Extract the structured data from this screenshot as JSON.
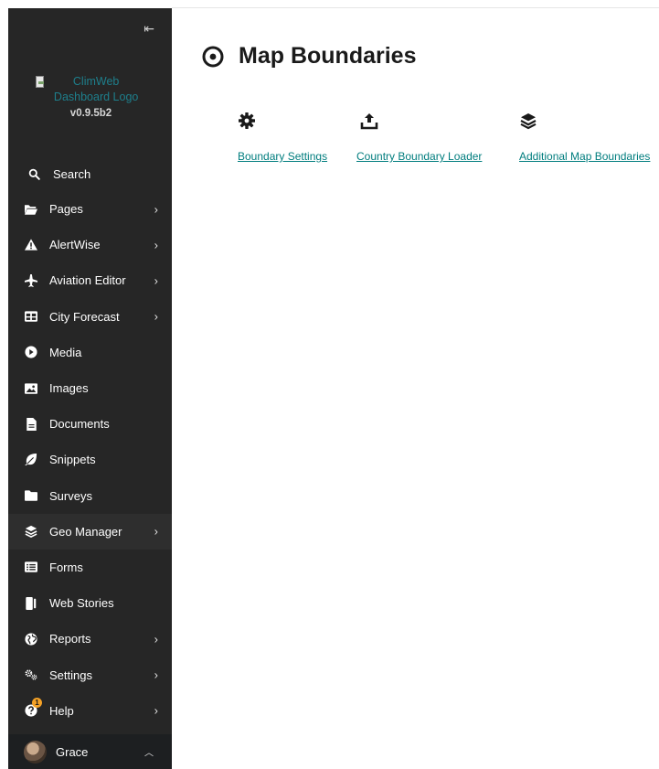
{
  "sidebar": {
    "collapse_label": "⇤",
    "logo_alt": "ClimWeb Dashboard Logo",
    "version": "v0.9.5b2",
    "search_label": "Search",
    "items": [
      {
        "label": "Pages",
        "icon": "folder-open-icon",
        "has_submenu": true
      },
      {
        "label": "AlertWise",
        "icon": "warning-icon",
        "has_submenu": true
      },
      {
        "label": "Aviation Editor",
        "icon": "plane-icon",
        "has_submenu": true
      },
      {
        "label": "City Forecast",
        "icon": "table-icon",
        "has_submenu": true
      },
      {
        "label": "Media",
        "icon": "play-circle-icon",
        "has_submenu": false
      },
      {
        "label": "Images",
        "icon": "image-icon",
        "has_submenu": false
      },
      {
        "label": "Documents",
        "icon": "document-icon",
        "has_submenu": false
      },
      {
        "label": "Snippets",
        "icon": "leaf-icon",
        "has_submenu": false
      },
      {
        "label": "Surveys",
        "icon": "folder-icon",
        "has_submenu": false
      },
      {
        "label": "Geo Manager",
        "icon": "layers-icon",
        "has_submenu": true,
        "active": true
      },
      {
        "label": "Forms",
        "icon": "list-alt-icon",
        "has_submenu": false
      },
      {
        "label": "Web Stories",
        "icon": "book-icon",
        "has_submenu": false
      },
      {
        "label": "Reports",
        "icon": "globe-icon",
        "has_submenu": true
      },
      {
        "label": "Settings",
        "icon": "cogs-icon",
        "has_submenu": true
      },
      {
        "label": "Help",
        "icon": "help-icon",
        "has_submenu": true,
        "badge": "1"
      }
    ],
    "user": {
      "name": "Grace"
    }
  },
  "main": {
    "title": "Map Boundaries",
    "title_icon": "eye-icon",
    "tiles": [
      {
        "label": "Boundary Settings",
        "icon": "gear-icon"
      },
      {
        "label": "Country Boundary Loader",
        "icon": "upload-icon"
      },
      {
        "label": "Additional Map Boundaries",
        "icon": "layers-icon"
      }
    ]
  },
  "colors": {
    "sidebar_bg": "#262626",
    "link": "#007d7e",
    "badge": "#f4a126"
  }
}
